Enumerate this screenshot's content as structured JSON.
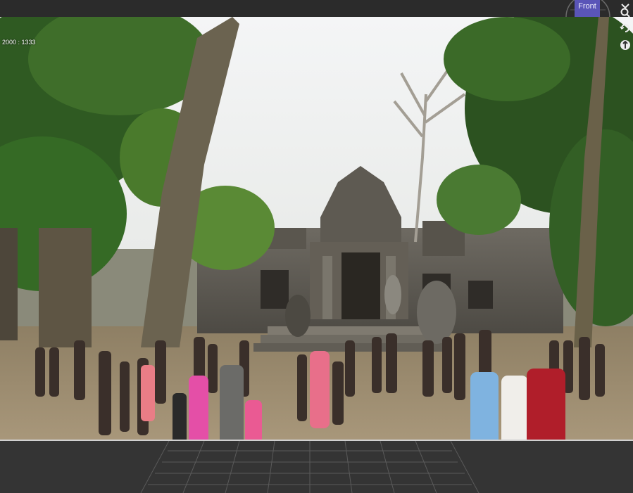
{
  "viewport": {
    "resolution_label": "2000 : 1333"
  },
  "camera": {
    "view_label": "Front"
  },
  "toolbar": {
    "icons": [
      "zoom-icon",
      "rotate-icon",
      "pan-icon"
    ]
  },
  "colors": {
    "accent": "#5a55b8",
    "background": "#2e2e2e",
    "grid": "#555555"
  }
}
